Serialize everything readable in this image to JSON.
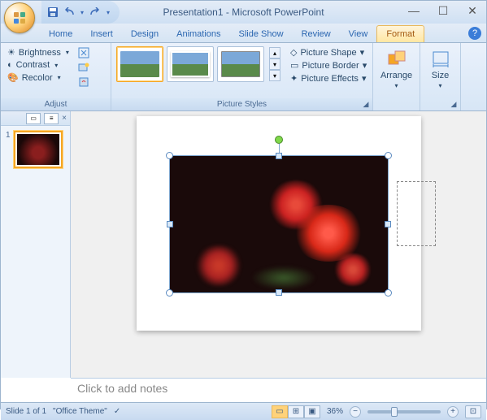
{
  "title": "Presentation1 - Microsoft PowerPoint",
  "qat": {
    "save": "save-icon",
    "undo": "undo-icon",
    "redo": "redo-icon"
  },
  "tabs": [
    "Home",
    "Insert",
    "Design",
    "Animations",
    "Slide Show",
    "Review",
    "View",
    "Format"
  ],
  "active_tab": "Format",
  "ribbon": {
    "adjust": {
      "label": "Adjust",
      "brightness": "Brightness",
      "contrast": "Contrast",
      "recolor": "Recolor"
    },
    "picture_styles": {
      "label": "Picture Styles",
      "shape": "Picture Shape",
      "border": "Picture Border",
      "effects": "Picture Effects"
    },
    "arrange": {
      "label": "Arrange"
    },
    "size": {
      "label": "Size"
    }
  },
  "slide_panel": {
    "slide_number": "1"
  },
  "notes": {
    "placeholder": "Click to add notes"
  },
  "status": {
    "slide": "Slide 1 of 1",
    "theme": "\"Office Theme\"",
    "zoom": "36%"
  }
}
